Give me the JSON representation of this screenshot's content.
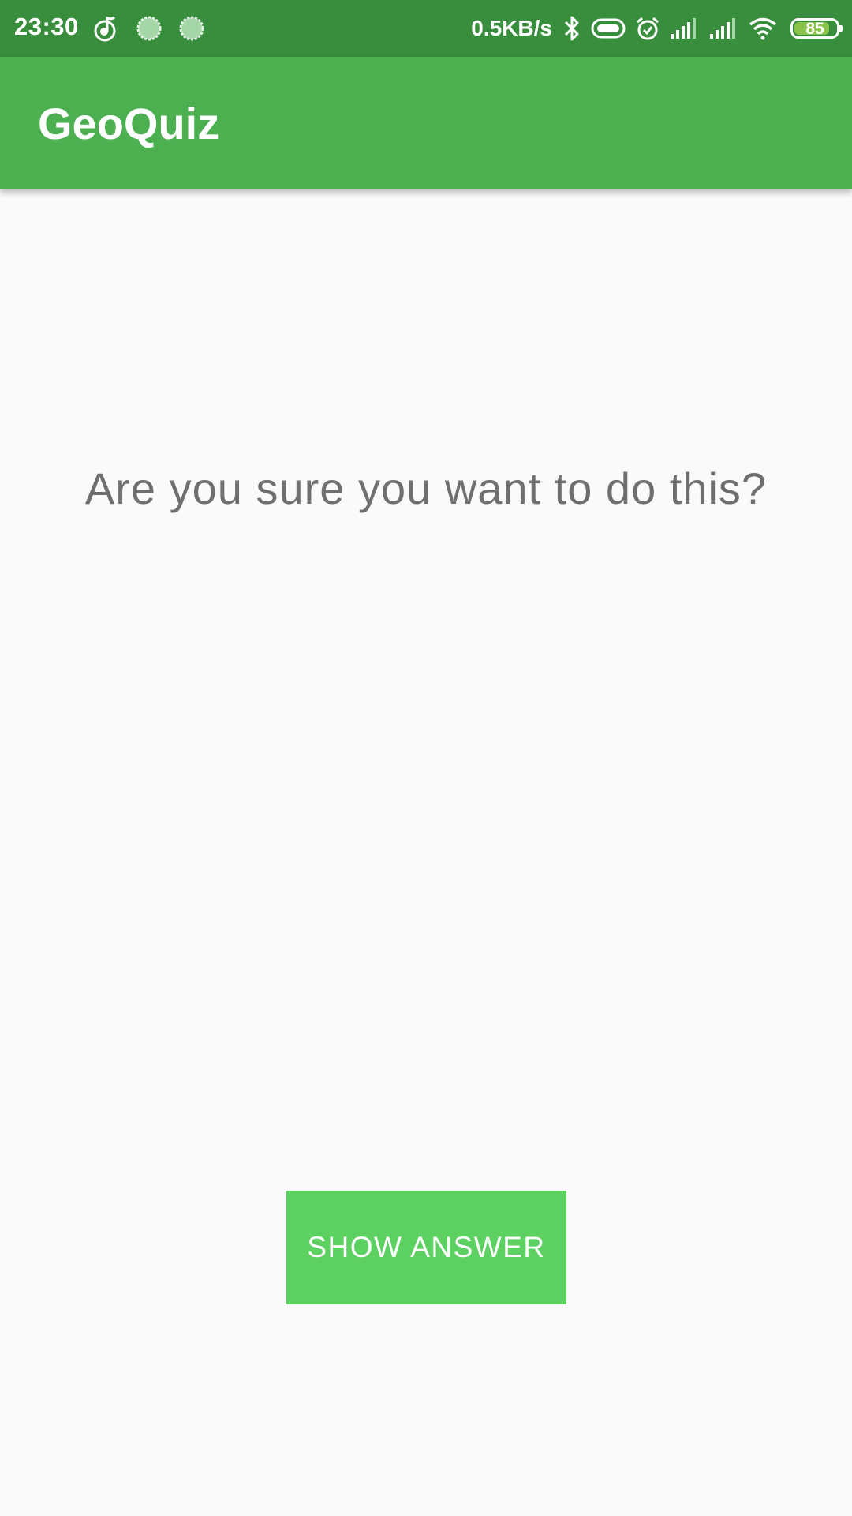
{
  "status_bar": {
    "time": "23:30",
    "net_speed": "0.5KB/s",
    "battery_level": "85",
    "battery_fraction": 0.85,
    "icons": [
      "music-icon",
      "sync-icon",
      "sync-icon",
      "bluetooth-icon",
      "nfc-icon",
      "alarm-icon",
      "signal-icon",
      "signal-icon",
      "wifi-icon",
      "battery-icon"
    ],
    "bar_color": "#388e3c",
    "battery_color": "#8bc34a"
  },
  "app_bar": {
    "title": "GeoQuiz",
    "color": "#4caf50"
  },
  "main": {
    "question": "Are you sure you want to do this?",
    "show_answer_label": "SHOW ANSWER",
    "button_color": "#5cd162",
    "text_color": "#6f6f6f",
    "background": "#fafafa"
  }
}
